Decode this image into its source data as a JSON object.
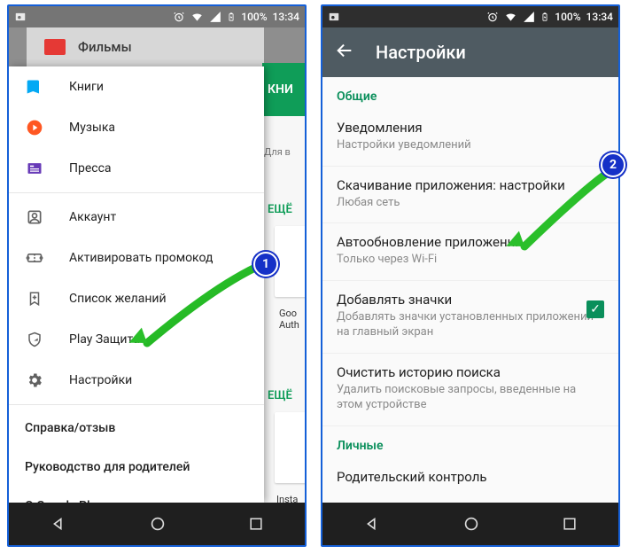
{
  "status_bar": {
    "battery": "100%",
    "time": "13:34"
  },
  "left": {
    "films_row": "Фильмы",
    "drawer": {
      "categories": [
        {
          "label": "Книги",
          "icon": "book-icon",
          "color": "#03a9f4"
        },
        {
          "label": "Музыка",
          "icon": "music-icon",
          "color": "#ff5722"
        },
        {
          "label": "Пресса",
          "icon": "press-icon",
          "color": "#673ab7"
        }
      ],
      "account": [
        {
          "label": "Аккаунт",
          "icon": "account-icon"
        },
        {
          "label": "Активировать промокод",
          "icon": "promo-icon"
        },
        {
          "label": "Список желаний",
          "icon": "wishlist-icon"
        },
        {
          "label": "Play Защита",
          "icon": "protect-icon"
        },
        {
          "label": "Настройки",
          "icon": "settings-icon"
        }
      ],
      "footer": [
        {
          "label": "Справка/отзыв"
        },
        {
          "label": "Руководство для родителей"
        },
        {
          "label": "О Google Play"
        }
      ]
    },
    "bg": {
      "tab": "КНИ",
      "hint": "Для в",
      "more": "ЕЩЁ",
      "goo": "Goo",
      "auth": "Auth",
      "inst": "Insta"
    }
  },
  "right": {
    "title": "Настройки",
    "section_general": "Общие",
    "section_personal": "Личные",
    "items": [
      {
        "t": "Уведомления",
        "s": "Настройки уведомлений"
      },
      {
        "t": "Скачивание приложения: настройки",
        "s": "Любая сеть"
      },
      {
        "t": "Автообновление приложений",
        "s": "Только через Wi-Fi"
      },
      {
        "t": "Добавлять значки",
        "s": "Добавлять значки установленных приложений на главный экран",
        "check": true
      },
      {
        "t": "Очистить историю поиска",
        "s": "Удалить поисковые запросы, введенные на этом устройстве"
      }
    ],
    "personal_first": {
      "t": "Родительский контроль"
    }
  },
  "annotations": {
    "one": "1",
    "two": "2"
  }
}
